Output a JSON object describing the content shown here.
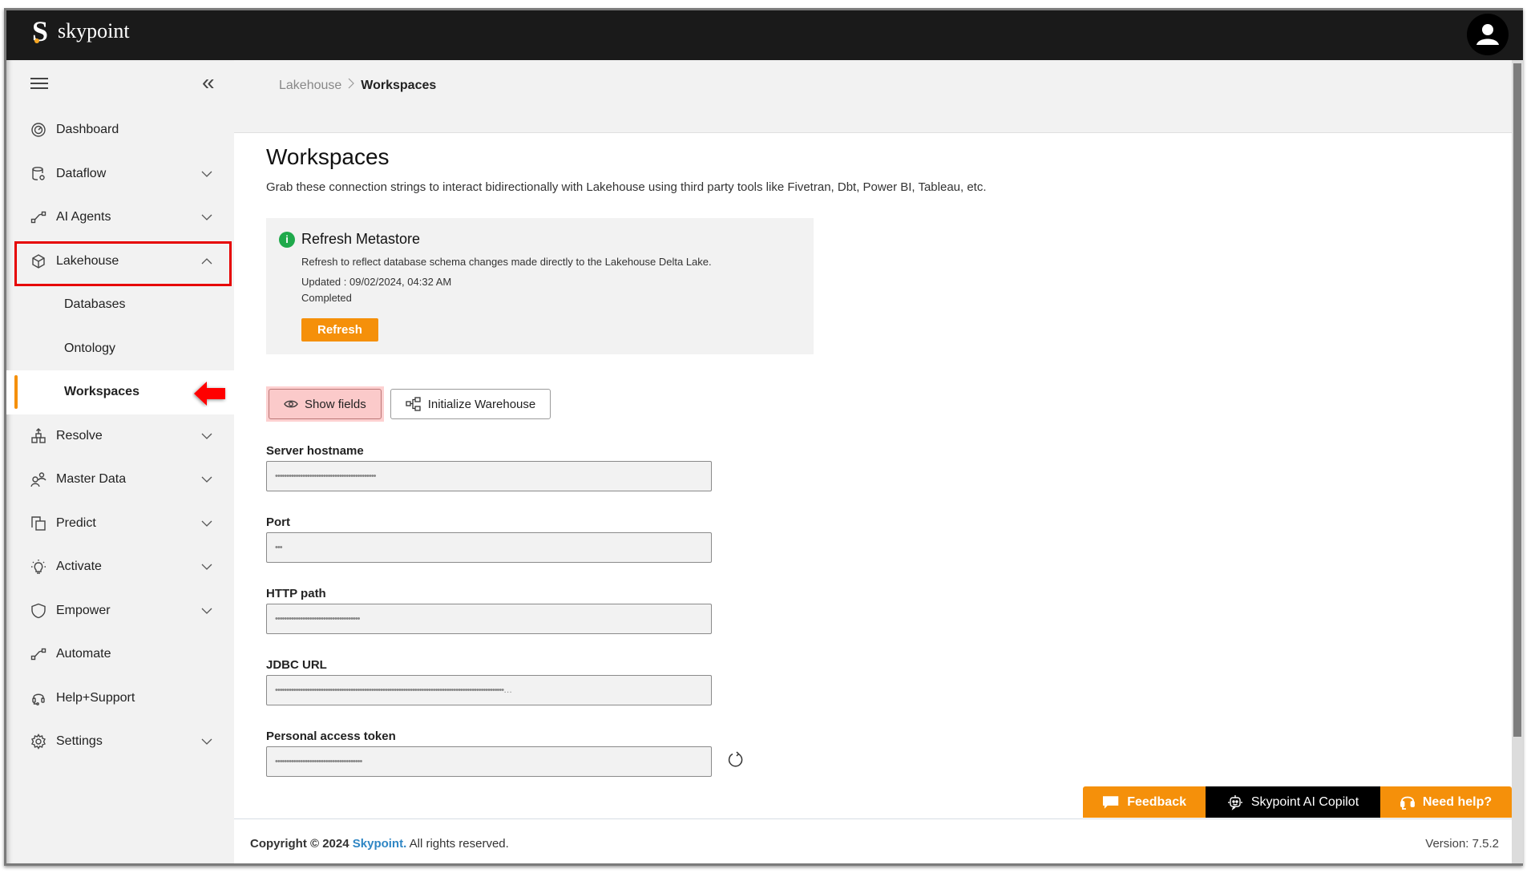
{
  "app": {
    "brand_mark": "S",
    "brand_name": "skypoint"
  },
  "sidebar": {
    "items": [
      {
        "label": "Dashboard",
        "icon": "gauge-icon",
        "has_chevron": false
      },
      {
        "label": "Dataflow",
        "icon": "database-gear-icon",
        "has_chevron": true
      },
      {
        "label": "AI Agents",
        "icon": "flow-icon",
        "has_chevron": true
      },
      {
        "label": "Lakehouse",
        "icon": "cube-icon",
        "has_chevron": true,
        "expanded": true,
        "highlighted": true,
        "children": [
          {
            "label": "Databases"
          },
          {
            "label": "Ontology"
          },
          {
            "label": "Workspaces",
            "active": true
          }
        ]
      },
      {
        "label": "Resolve",
        "icon": "hierarchy-icon",
        "has_chevron": true
      },
      {
        "label": "Master Data",
        "icon": "people-icon",
        "has_chevron": true
      },
      {
        "label": "Predict",
        "icon": "predict-icon",
        "has_chevron": true
      },
      {
        "label": "Activate",
        "icon": "lightbulb-icon",
        "has_chevron": true
      },
      {
        "label": "Empower",
        "icon": "shield-icon",
        "has_chevron": true
      },
      {
        "label": "Automate",
        "icon": "flow-icon",
        "has_chevron": false
      },
      {
        "label": "Help+Support",
        "icon": "headset-icon",
        "has_chevron": false
      },
      {
        "label": "Settings",
        "icon": "gear-icon",
        "has_chevron": true
      }
    ]
  },
  "breadcrumb": {
    "parent": "Lakehouse",
    "current": "Workspaces"
  },
  "page": {
    "title": "Workspaces",
    "description": "Grab these connection strings to interact bidirectionally with Lakehouse using third party tools like Fivetran, Dbt, Power BI, Tableau, etc."
  },
  "metastore": {
    "title": "Refresh Metastore",
    "description": "Refresh to reflect database schema changes made directly to the Lakehouse Delta Lake.",
    "updated": "Updated : 09/02/2024, 04:32 AM",
    "status": "Completed",
    "refresh_label": "Refresh",
    "status_color": "#1fa94b"
  },
  "actions": {
    "show_fields_label": "Show fields",
    "initialize_warehouse_label": "Initialize Warehouse"
  },
  "fields": [
    {
      "label": "Server hostname",
      "value": "••••••••••••••••••••••••••••••••••••••••••••"
    },
    {
      "label": "Port",
      "value": "•••"
    },
    {
      "label": "HTTP path",
      "value": "•••••••••••••••••••••••••••••••••••••"
    },
    {
      "label": "JDBC URL",
      "value": "••••••••••••••••••••••••••••••••••••••••••••••••••••••••••••••••••••••••••••••••••••••••••••••••••••…"
    },
    {
      "label": "Personal access token",
      "value": "••••••••••••••••••••••••••••••••••••••",
      "regenerate": true
    }
  ],
  "floating": {
    "feedback_label": "Feedback",
    "copilot_label": "Skypoint AI Copilot",
    "help_label": "Need help?"
  },
  "footer": {
    "copyright_prefix": "Copyright © 2024 ",
    "brand": "Skypoint.",
    "rights": " All rights reserved.",
    "version": "Version: 7.5.2"
  },
  "colors": {
    "accent_orange": "#f5900a",
    "highlight_red": "#e60000",
    "brand_link": "#2f86c4",
    "topbar": "#1a1a1a"
  }
}
